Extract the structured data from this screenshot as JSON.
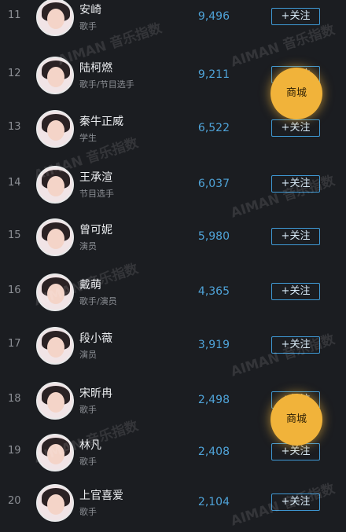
{
  "rows": [
    {
      "rank": "11",
      "name": "安崎",
      "role": "歌手",
      "score": "9,496",
      "follow_label": "+关注",
      "avatar_icon": "avatar-icon"
    },
    {
      "rank": "12",
      "name": "陆柯燃",
      "role": "歌手/节目选手",
      "score": "9,211",
      "follow_label": "+关注",
      "avatar_icon": "avatar-icon"
    },
    {
      "rank": "13",
      "name": "秦牛正威",
      "role": "学生",
      "score": "6,522",
      "follow_label": "+关注",
      "avatar_icon": "avatar-icon"
    },
    {
      "rank": "14",
      "name": "王承渲",
      "role": "节目选手",
      "score": "6,037",
      "follow_label": "+关注",
      "avatar_icon": "avatar-icon"
    },
    {
      "rank": "15",
      "name": "曾可妮",
      "role": "演员",
      "score": "5,980",
      "follow_label": "+关注",
      "avatar_icon": "avatar-icon"
    },
    {
      "rank": "16",
      "name": "戴萌",
      "role": "歌手/演员",
      "score": "4,365",
      "follow_label": "+关注",
      "avatar_icon": "avatar-icon"
    },
    {
      "rank": "17",
      "name": "段小薇",
      "role": "演员",
      "score": "3,919",
      "follow_label": "+关注",
      "avatar_icon": "avatar-icon"
    },
    {
      "rank": "18",
      "name": "宋昕冉",
      "role": "歌手",
      "score": "2,498",
      "follow_label": "+关注",
      "avatar_icon": "avatar-icon"
    },
    {
      "rank": "19",
      "name": "林凡",
      "role": "歌手",
      "score": "2,408",
      "follow_label": "+关注",
      "avatar_icon": "avatar-icon"
    },
    {
      "rank": "20",
      "name": "上官喜爱",
      "role": "歌手",
      "score": "2,104",
      "follow_label": "+关注",
      "avatar_icon": "avatar-icon"
    }
  ],
  "mall_buttons": [
    {
      "label": "商城"
    },
    {
      "label": "商城"
    }
  ],
  "watermark": {
    "text": "AIMAN 音乐指数"
  },
  "colors": {
    "background": "#1b1d21",
    "score": "#4fa3d8",
    "follow_border": "#3f9ad6",
    "mall": "#f1b33a"
  }
}
